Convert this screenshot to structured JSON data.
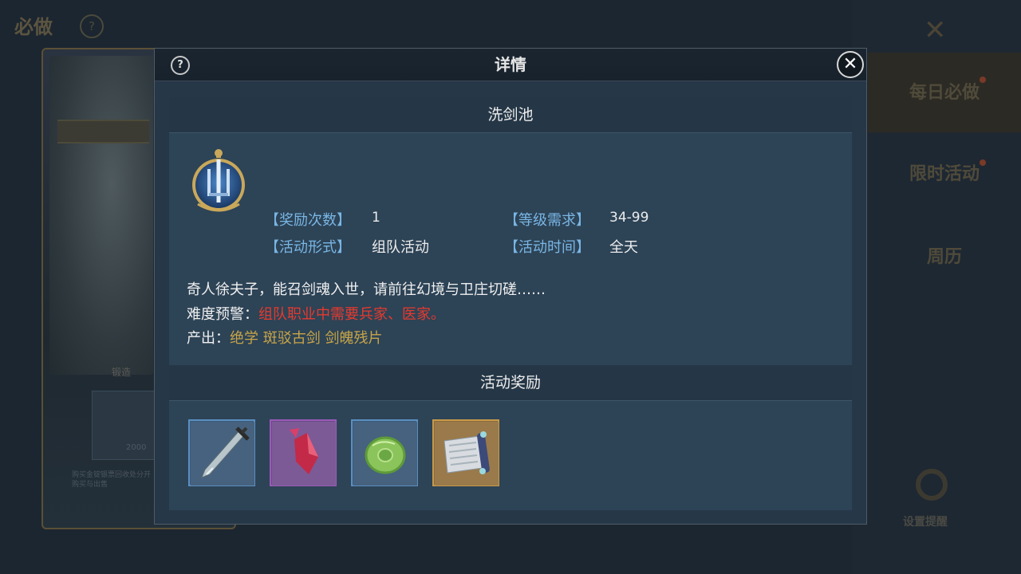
{
  "background": {
    "top_title": "必做",
    "card_label": "锻造",
    "item_count": "2000",
    "card_desc": "购买金锭银票回收处分开购买与出售",
    "side_tabs": [
      "每日必做",
      "限时活动",
      "周历"
    ],
    "gear_label": "设置提醒"
  },
  "modal": {
    "title": "详情",
    "help_symbol": "?",
    "close_symbol": "✕"
  },
  "activity": {
    "name": "洗剑池",
    "reward_count_label": "【奖励次数】",
    "reward_count_value": "1",
    "level_req_label": "【等级需求】",
    "level_req_value": "34-99",
    "format_label": "【活动形式】",
    "format_value": "组队活动",
    "time_label": "【活动时间】",
    "time_value": "全天",
    "description": "奇人徐夫子，能召剑魂入世，请前往幻境与卫庄切磋……",
    "warning_label": "难度预警：",
    "warning_value": "组队职业中需要兵家、医家。",
    "output_label": "产出：",
    "output_value": "绝学 斑驳古剑 剑魄残片"
  },
  "rewards": {
    "title": "活动奖励",
    "items": [
      {
        "icon": "sword-icon",
        "quality_color": "#5a8fc0"
      },
      {
        "icon": "red-crystal-icon",
        "quality_color": "#9a5ab8"
      },
      {
        "icon": "jade-disc-icon",
        "quality_color": "#5a8fc0"
      },
      {
        "icon": "scroll-icon",
        "quality_color": "#c89a4a"
      }
    ]
  },
  "colors": {
    "label_blue": "#79b6e4",
    "warning_red": "#e63a2e",
    "output_gold": "#c8a548"
  }
}
